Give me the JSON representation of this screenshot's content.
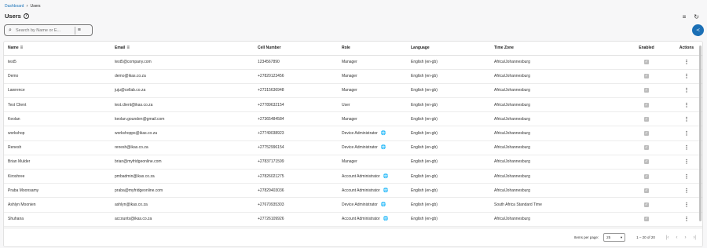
{
  "breadcrumb": {
    "parent": "Dashboard",
    "separator": "›",
    "current": "Users"
  },
  "page": {
    "title": "Users",
    "help_icon": "?"
  },
  "top_actions": {
    "sort_icon": "≡",
    "refresh_icon": "↻"
  },
  "search": {
    "placeholder": "Search by Name or E...",
    "icon": "⌕",
    "filter_icon": "≡"
  },
  "fab": {
    "icon": "≺"
  },
  "table": {
    "headers": {
      "name": "Name",
      "email": "Email",
      "cell": "Cell Number",
      "role": "Role",
      "language": "Language",
      "timezone": "Time Zone",
      "enabled": "Enabled",
      "actions": "Actions"
    },
    "sort_icon": "≡",
    "rows": [
      {
        "name": "test5",
        "email": "test5@company.com",
        "cell": "1234567890",
        "role": "Manager",
        "globe": "",
        "language": "English (en-gb)",
        "timezone": "Africa/Johannesburg",
        "enabled": "✓",
        "action": "⋮"
      },
      {
        "name": "Demo",
        "email": "demo@ikas.co.za",
        "cell": "+27820123456",
        "role": "Manager",
        "globe": "",
        "language": "English (en-gb)",
        "timezone": "Africa/Johannesburg",
        "enabled": "✓",
        "action": "⋮"
      },
      {
        "name": "Lawrence",
        "email": "juju@cellab.co.za",
        "cell": "+27315636948",
        "role": "Manager",
        "globe": "",
        "language": "English (en-gb)",
        "timezone": "Africa/Johannesburg",
        "enabled": "✓",
        "action": "⋮"
      },
      {
        "name": "Test Client",
        "email": "test.client@ikas.co.za",
        "cell": "+27789632154",
        "role": "User",
        "globe": "",
        "language": "English (en-gb)",
        "timezone": "Africa/Johannesburg",
        "enabled": "✓",
        "action": "⋮"
      },
      {
        "name": "Keolan",
        "email": "keolan.gounden@gmail.com",
        "cell": "+27365484584",
        "role": "Manager",
        "globe": "",
        "language": "English (en-gb)",
        "timezone": "Africa/Johannesburg",
        "enabled": "✓",
        "action": "⋮"
      },
      {
        "name": "workshop",
        "email": "workshopps@ikas.co.za",
        "cell": "+27749038923",
        "role": "Device Administrator",
        "globe": "🌐",
        "language": "English (en-gb)",
        "timezone": "Africa/Johannesburg",
        "enabled": "✓",
        "action": "⋮"
      },
      {
        "name": "Renesh",
        "email": "renesh@ikas.co.za",
        "cell": "+27752996154",
        "role": "Device Administrator",
        "globe": "🌐",
        "language": "English (en-gb)",
        "timezone": "Africa/Johannesburg",
        "enabled": "✓",
        "action": "⋮"
      },
      {
        "name": "Brian Mulder",
        "email": "brian@myfridgeonline.com",
        "cell": "+27837171599",
        "role": "Manager",
        "globe": "",
        "language": "English (en-gb)",
        "timezone": "Africa/Johannesburg",
        "enabled": "✓",
        "action": "⋮"
      },
      {
        "name": "Kiroshree",
        "email": "pmbadmin@ikas.co.za",
        "cell": "+27826021275",
        "role": "Account Administrator",
        "globe": "🌐",
        "language": "English (en-gb)",
        "timezone": "Africa/Johannesburg",
        "enabled": "✓",
        "action": "⋮"
      },
      {
        "name": "Praba Moonsamy",
        "email": "praba@myfridgeonline.com",
        "cell": "+27829403036",
        "role": "Account Administrator",
        "globe": "🌐",
        "language": "English (en-gb)",
        "timezone": "Africa/Johannesburg",
        "enabled": "✓",
        "action": "⋮"
      },
      {
        "name": "Ashlyn Moonien",
        "email": "ashlyn@ikas.co.za",
        "cell": "+27670935303",
        "role": "Device Administrator",
        "globe": "🌐",
        "language": "English (en-gb)",
        "timezone": "South Africa Standard Time",
        "enabled": "✓",
        "action": "⋮"
      },
      {
        "name": "Shuhana",
        "email": "accounts@ikas.co.za",
        "cell": "+27726109926",
        "role": "Account Administrator",
        "globe": "🌐",
        "language": "English (en-gb)",
        "timezone": "Africa/Johannesburg",
        "enabled": "✓",
        "action": "⋮"
      }
    ]
  },
  "pagination": {
    "items_per_page_label": "Items per page:",
    "items_per_page": "25",
    "dropdown_icon": "▾",
    "range": "1 – 20 of 20",
    "first_icon": "|‹",
    "prev_icon": "‹",
    "next_icon": "›",
    "last_icon": "›|"
  }
}
